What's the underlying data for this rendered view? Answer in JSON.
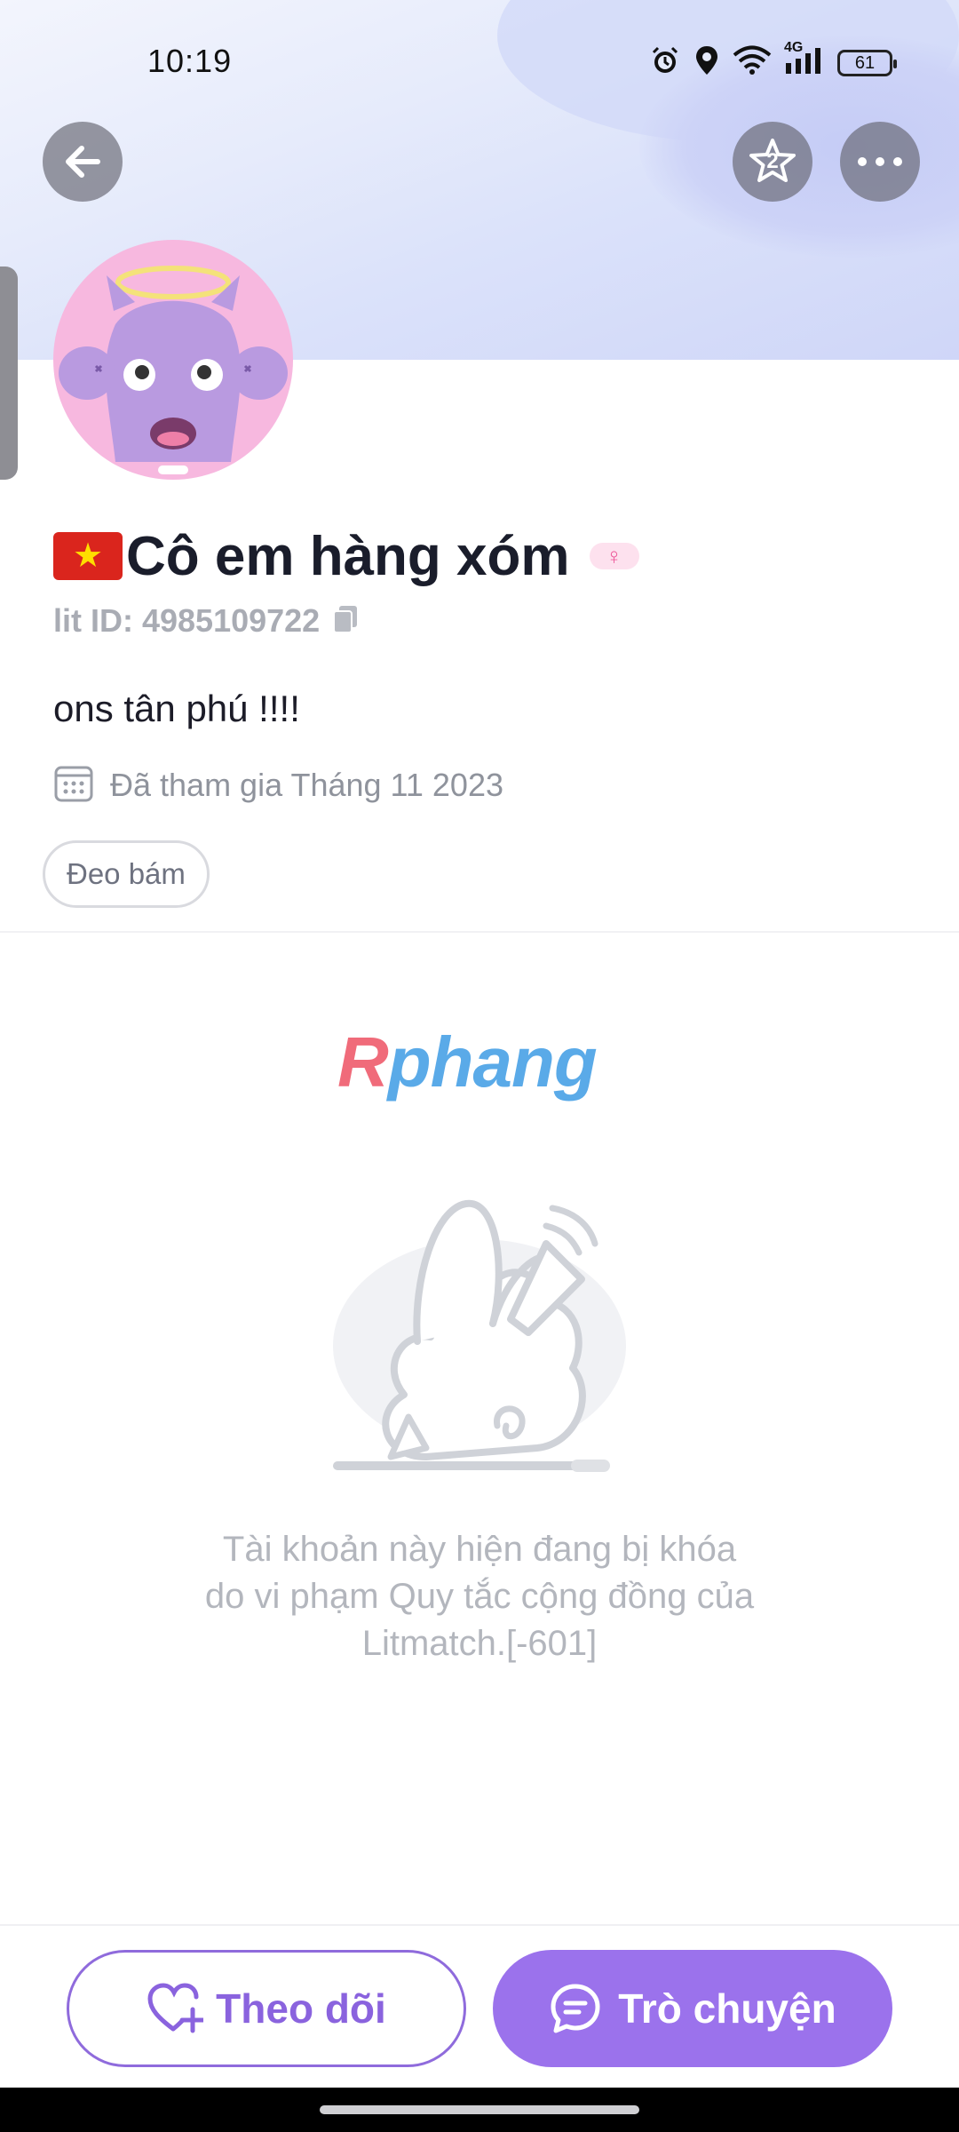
{
  "status_bar": {
    "time": "10:19",
    "network": "4G",
    "battery": "61",
    "icons": [
      "alarm-icon",
      "location-icon",
      "wifi-icon",
      "signal-icon",
      "battery-icon"
    ]
  },
  "header": {
    "back_icon": "arrow-left-icon",
    "star_icon": "star-badge-icon",
    "star_badge_count": "2",
    "more_icon": "more-horizontal-icon"
  },
  "profile": {
    "flag": "vietnam-flag",
    "name": "Cô em hàng xóm",
    "gender_icon": "female-symbol-icon",
    "gender_symbol": "♀",
    "lit_id": "lit ID: 4985109722",
    "bio": "ons tân phú !!!!",
    "joined": "Đã tham gia Tháng 11 2023",
    "tag": "Đeo bám"
  },
  "watermark": {
    "first": "R",
    "rest": "phang"
  },
  "locked_message": {
    "line1": "Tài khoản này hiện đang bị khóa",
    "line2": "do vi phạm Quy tắc cộng đồng của",
    "line3": "Litmatch.[-601]"
  },
  "actions": {
    "follow_label": "Theo dõi",
    "chat_label": "Trò chuyện"
  },
  "colors": {
    "accent": "#9b72ec",
    "follow_text": "#8a63de",
    "gender_pink": "#ee5b9b",
    "muted_text": "#b3b6bd"
  }
}
